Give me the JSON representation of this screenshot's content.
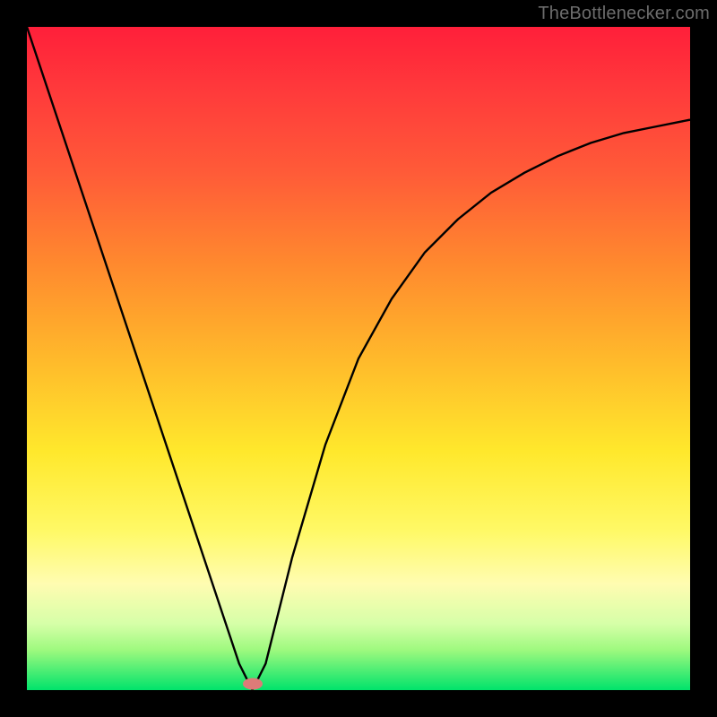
{
  "watermark": "TheBottlenecker.com",
  "chart_data": {
    "type": "line",
    "title": "",
    "xlabel": "",
    "ylabel": "",
    "xlim": [
      0,
      100
    ],
    "ylim": [
      0,
      100
    ],
    "series": [
      {
        "name": "bottleneck-curve",
        "x": [
          0,
          5,
          10,
          15,
          20,
          25,
          30,
          32,
          34,
          36,
          38,
          40,
          45,
          50,
          55,
          60,
          65,
          70,
          75,
          80,
          85,
          90,
          95,
          100
        ],
        "values": [
          100,
          85,
          70,
          55,
          40,
          25,
          10,
          4,
          0,
          4,
          12,
          20,
          37,
          50,
          59,
          66,
          71,
          75,
          78,
          80.5,
          82.5,
          84,
          85,
          86
        ]
      }
    ],
    "marker": {
      "x": 34,
      "y": 1
    },
    "background": {
      "type": "vertical-gradient",
      "stops": [
        {
          "pct": 0,
          "color": "#ff1f3a"
        },
        {
          "pct": 50,
          "color": "#ffe82c"
        },
        {
          "pct": 100,
          "color": "#00e36b"
        }
      ]
    }
  }
}
